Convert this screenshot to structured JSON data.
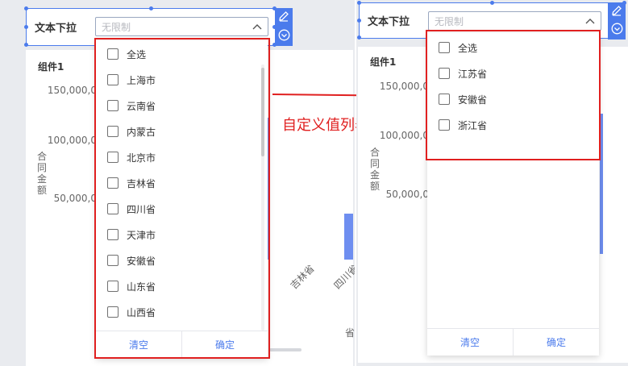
{
  "colors": {
    "accent": "#4b7bec",
    "highlight": "#e02020",
    "bar": "#6e8ef0"
  },
  "annotation": "自定义值列表后",
  "left": {
    "filter_label": "文本下拉",
    "select_placeholder": "无限制",
    "chart_title": "组件1",
    "y_axis_label": "合同金额",
    "y_ticks": [
      "150,000,0",
      "100,000,0",
      "50,000,0"
    ],
    "x_ticks": [
      "吉林省",
      "四川省"
    ],
    "x_axis_label": "省",
    "options": [
      "全选",
      "上海市",
      "云南省",
      "内蒙古",
      "北京市",
      "吉林省",
      "四川省",
      "天津市",
      "安徽省",
      "山东省",
      "山西省"
    ],
    "clear_label": "清空",
    "confirm_label": "确定"
  },
  "right": {
    "filter_label": "文本下拉",
    "select_placeholder": "无限制",
    "chart_title": "组件1",
    "y_axis_label": "合同金额",
    "y_ticks": [
      "150,000,0",
      "100,000,0",
      "50,000,0"
    ],
    "options": [
      "全选",
      "江苏省",
      "安徽省",
      "浙江省"
    ],
    "clear_label": "清空",
    "confirm_label": "确定"
  }
}
